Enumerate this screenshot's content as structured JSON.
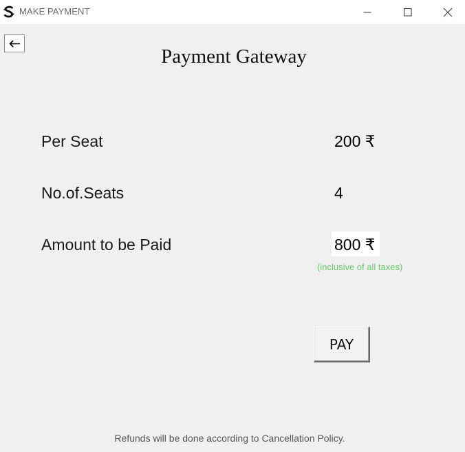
{
  "window": {
    "title": "MAKE PAYMENT",
    "controls": {
      "minimize_icon": "minimize-icon",
      "maximize_icon": "maximize-icon",
      "close_icon": "close-icon"
    }
  },
  "nav": {
    "back_icon": "arrow-left-icon",
    "back_glyph": "←"
  },
  "page": {
    "title": "Payment Gateway"
  },
  "details": {
    "per_seat": {
      "label": "Per Seat",
      "value": "200 ₹"
    },
    "seats": {
      "label": "No.of.Seats",
      "value": "4"
    },
    "amount": {
      "label": "Amount to be Paid",
      "value": "800 ₹",
      "note": "(inclusive of all taxes)"
    }
  },
  "actions": {
    "pay_label": "PAY"
  },
  "footer": {
    "refund_note": "Refunds will be done according to Cancellation Policy."
  },
  "colors": {
    "window_background": "#f0f0f0",
    "titlebar_background": "#ffffff",
    "tax_note": "#66cc66"
  }
}
